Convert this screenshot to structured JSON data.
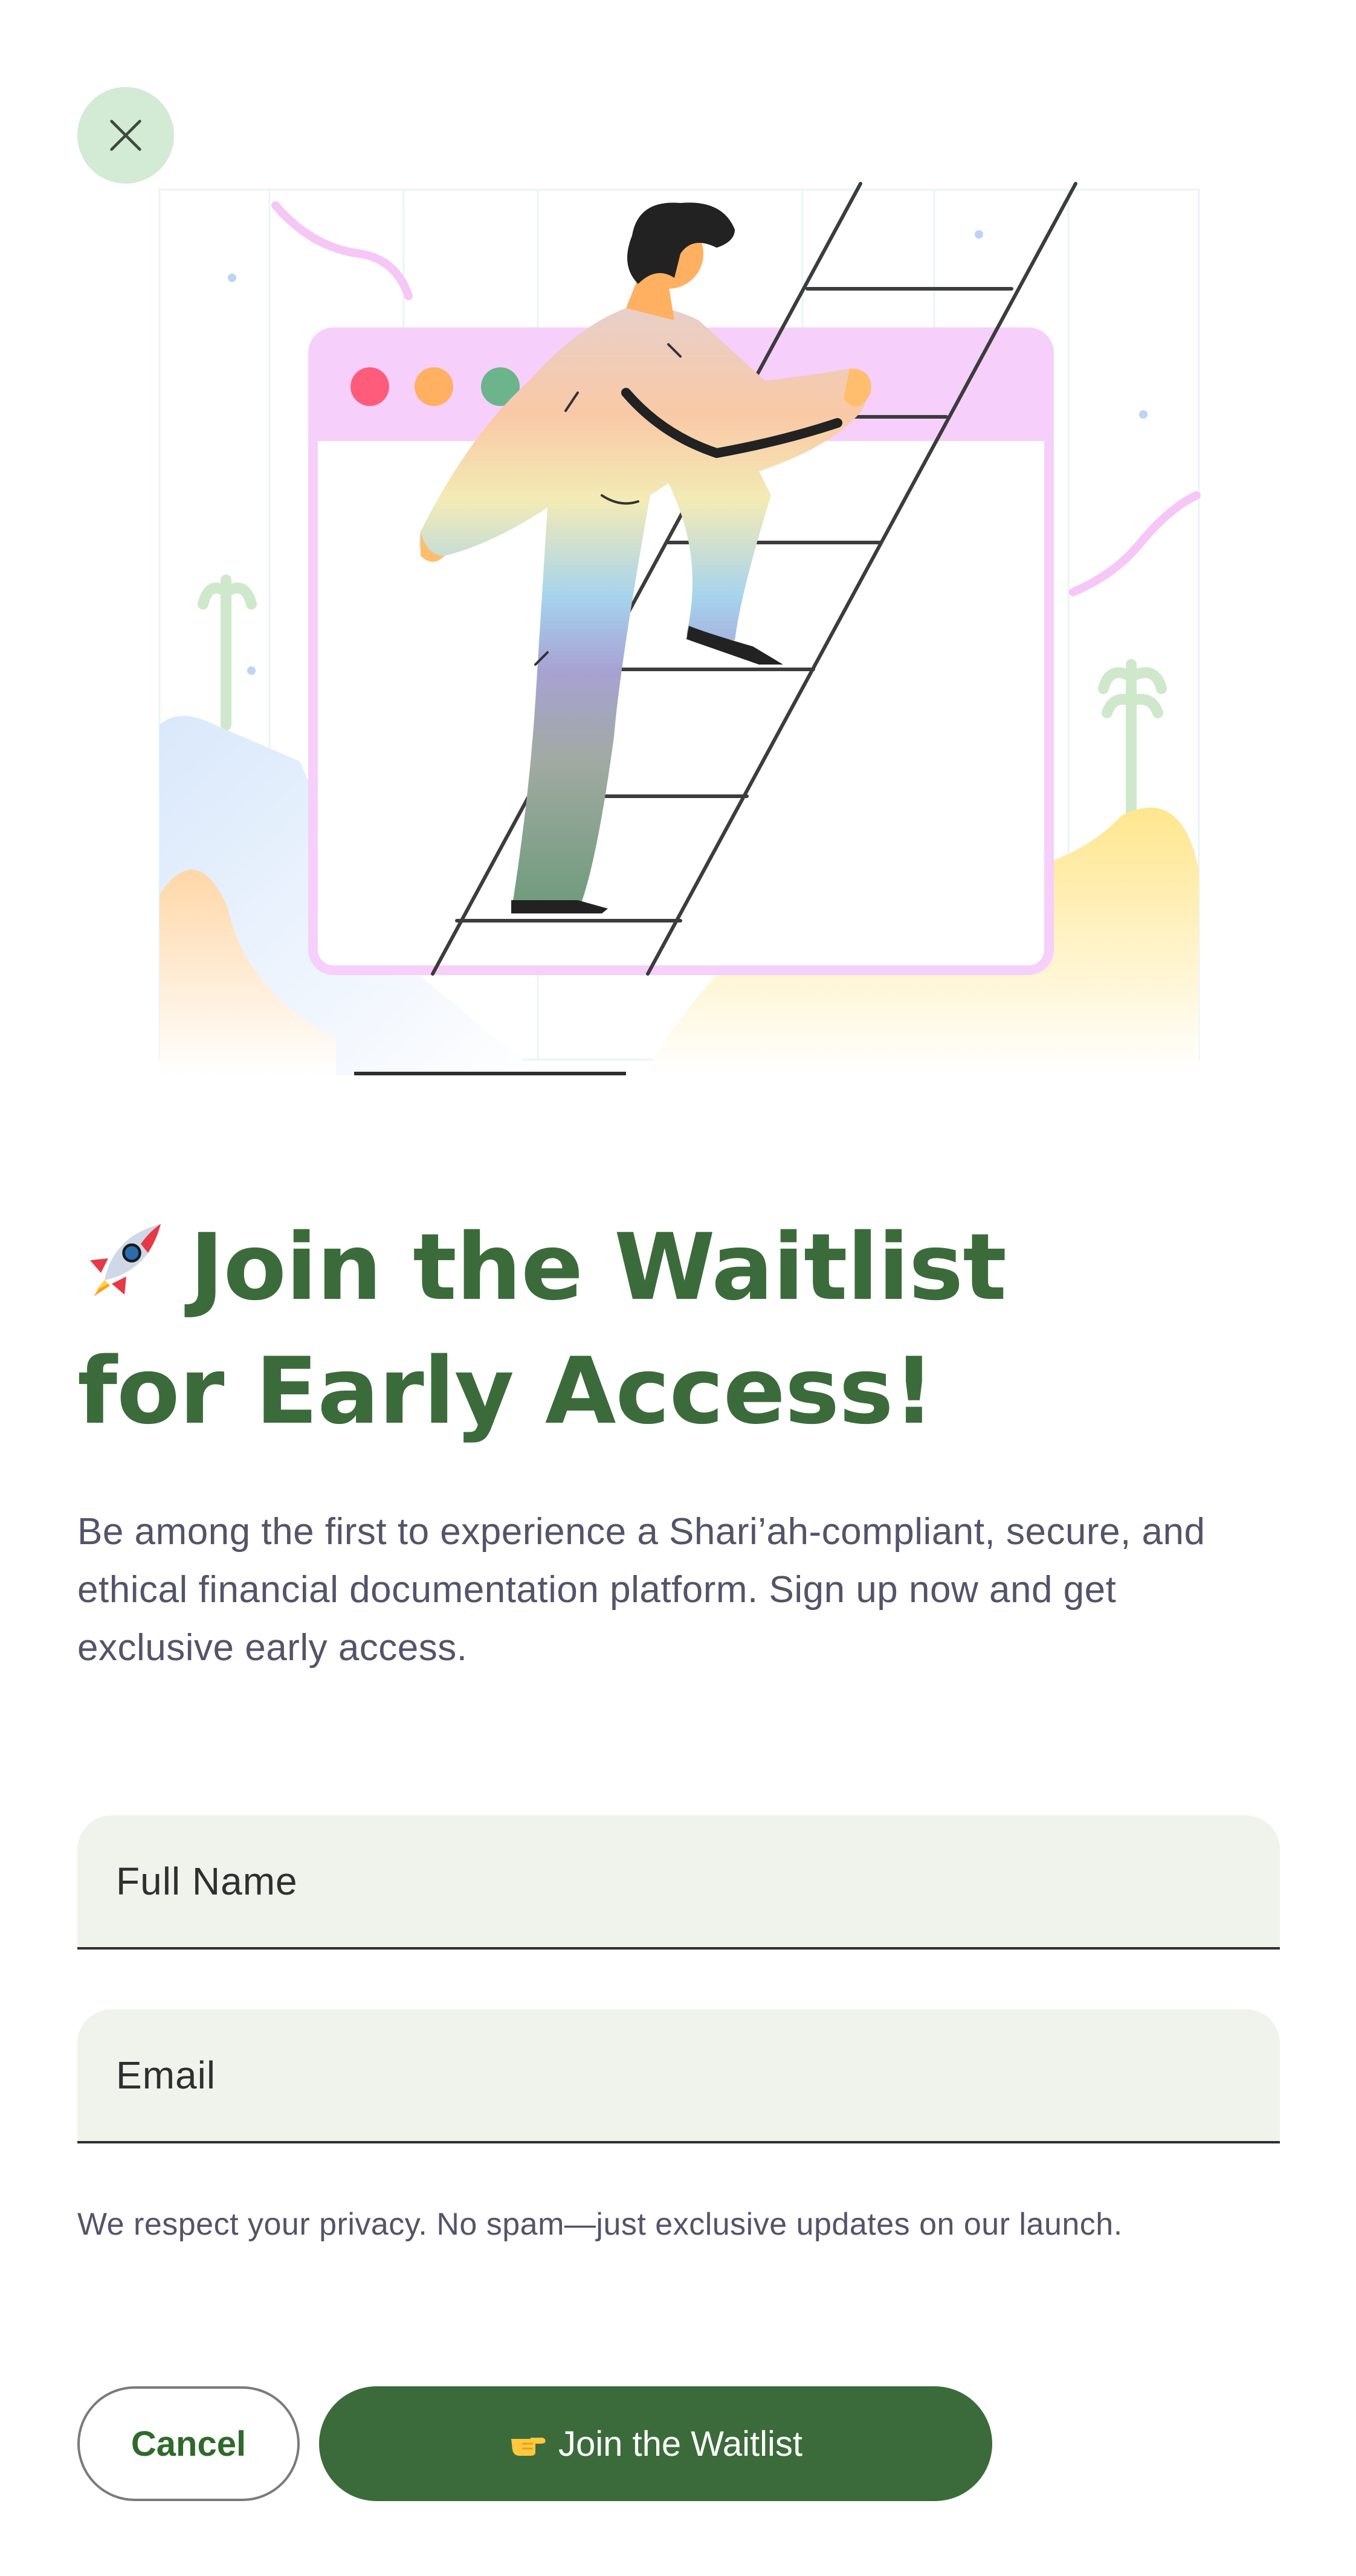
{
  "close": {
    "icon": "close-icon"
  },
  "illustration": {
    "icon": "person-climbing-ladder-illustration"
  },
  "heading": {
    "icon": "rocket-icon",
    "line1": "Join the Waitlist",
    "line2": "for Early Access!"
  },
  "description": "Be among the first to experience a Shari’ah-compliant, secure, and ethical financial documentation platform. Sign up now and get exclusive early access.",
  "form": {
    "full_name": {
      "placeholder": "Full Name",
      "value": ""
    },
    "email": {
      "placeholder": "Email",
      "value": ""
    }
  },
  "privacy_note": "We respect your privacy. No spam—just exclusive updates on our launch.",
  "buttons": {
    "cancel": "Cancel",
    "join": "Join the Waitlist",
    "join_icon": "pointing-hand-icon"
  },
  "colors": {
    "primary": "#3b6b3a",
    "close_bg": "#d3ead4",
    "field_bg": "#f0f3eb",
    "text_muted": "#54536a"
  }
}
